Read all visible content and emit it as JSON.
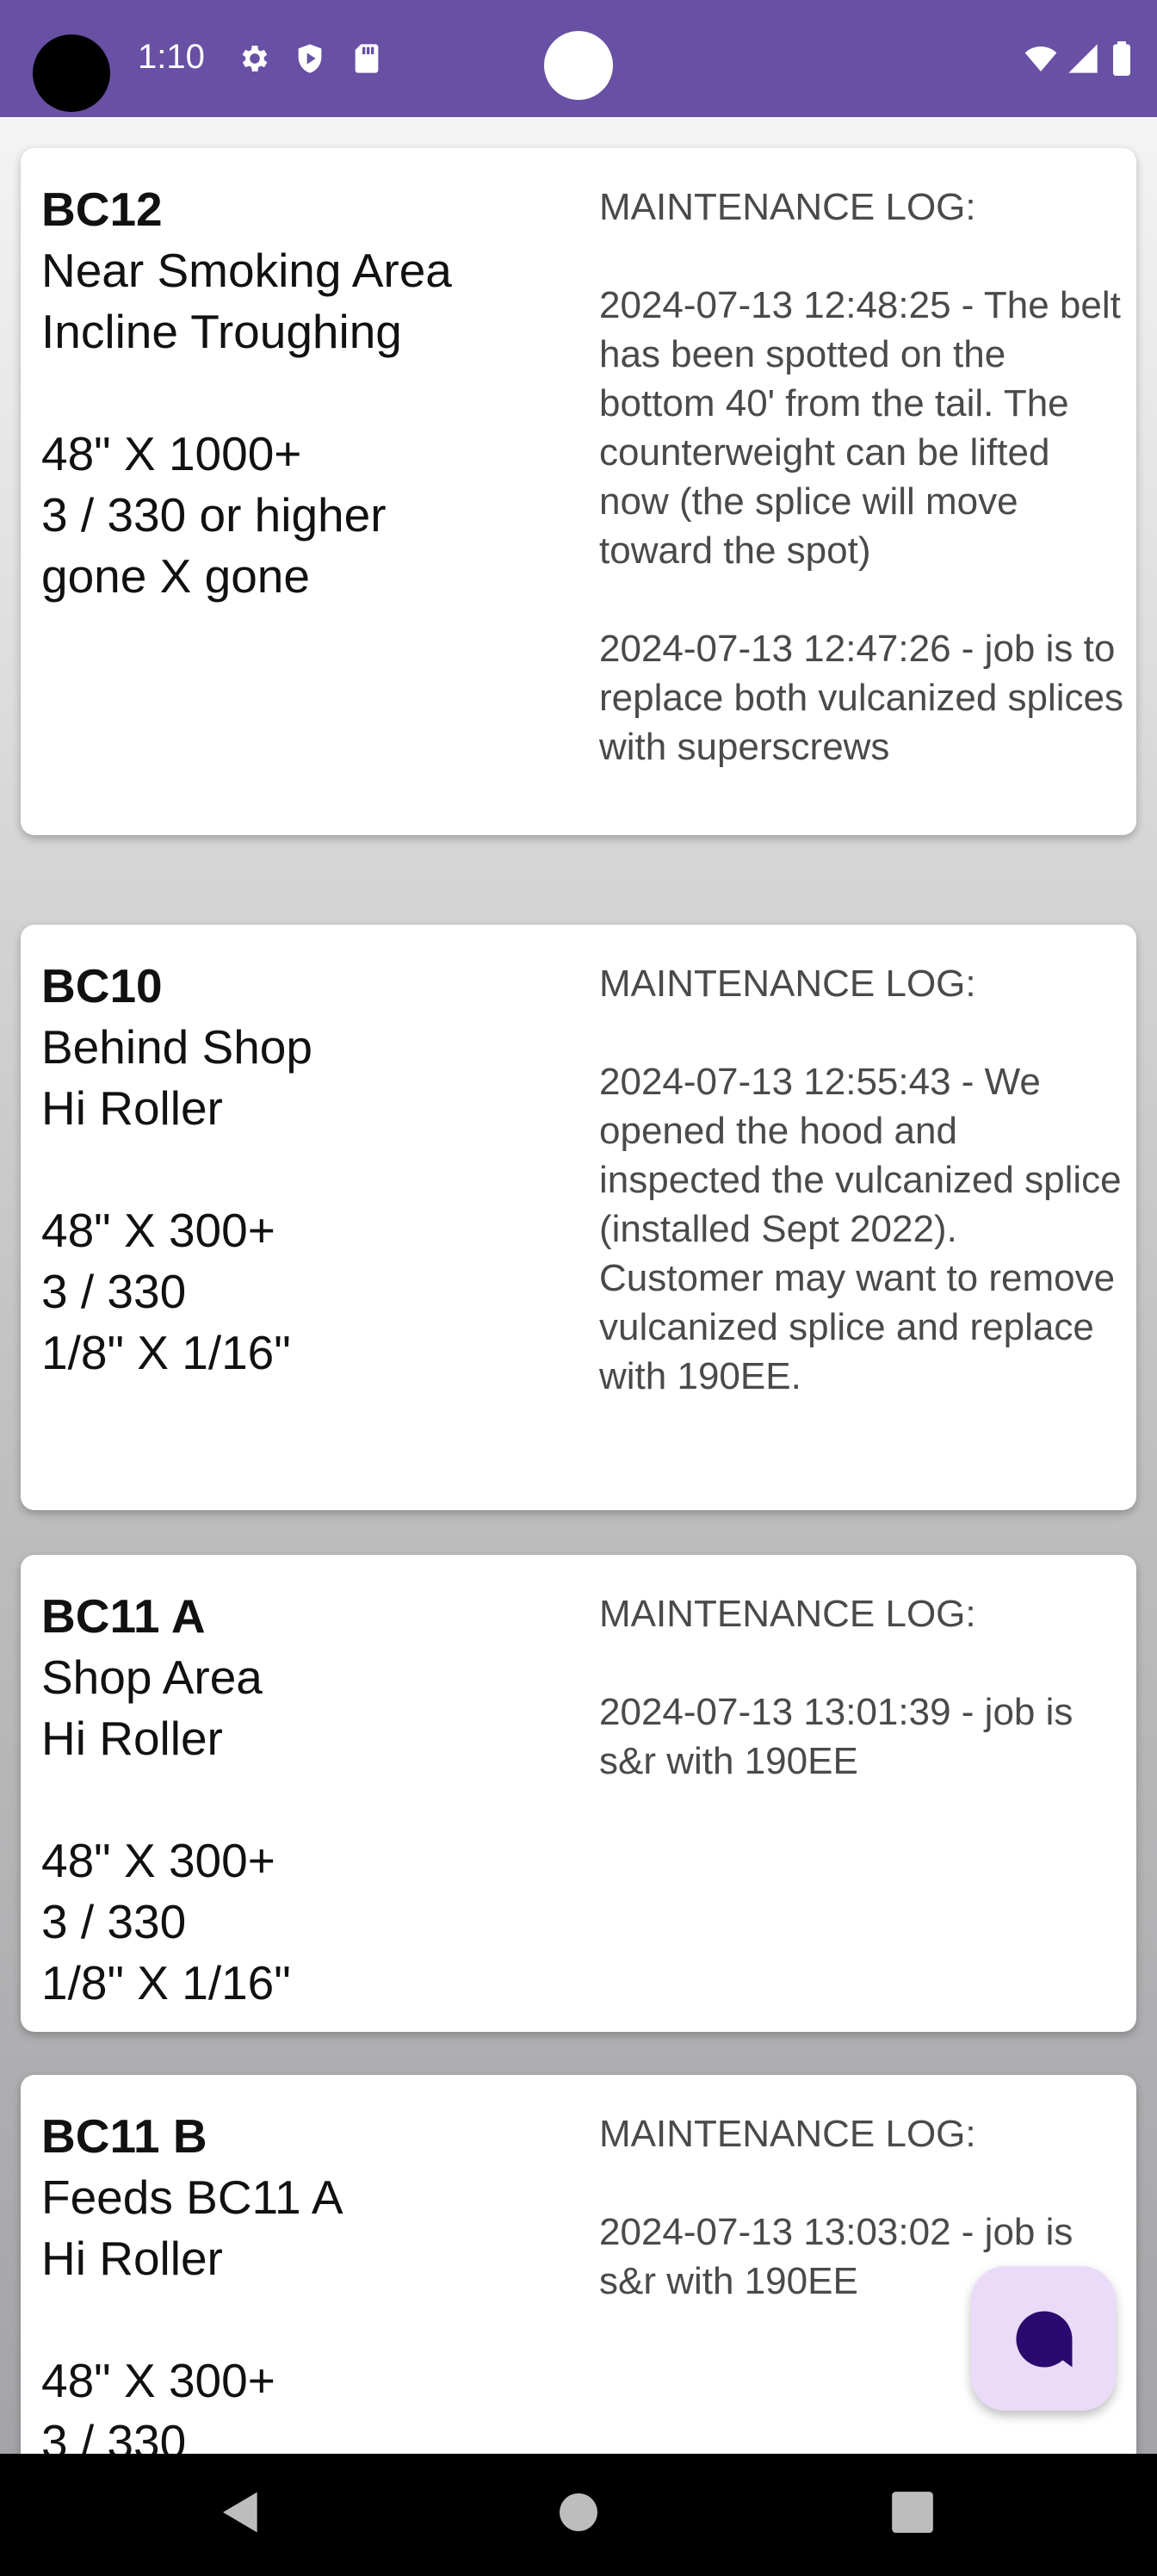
{
  "status_bar": {
    "time": "1:10",
    "icons": [
      "settings-gear-icon",
      "shield-icon",
      "sd-card-icon",
      "wifi-icon",
      "signal-icon",
      "battery-icon"
    ],
    "color": "#6850a4"
  },
  "cards": [
    {
      "code": "BC12",
      "location": "Near Smoking Area",
      "type": "Incline Troughing",
      "size": "48\" X 1000+",
      "ply": "3 / 330 or higher",
      "cover": "gone X gone",
      "log_header": "MAINTENANCE LOG:",
      "log_entries": [
        "2024-07-13 12:48:25 - The belt has been spotted on the bottom 40' from the tail. The counterweight can be lifted now (the splice will move toward the spot)",
        "2024-07-13 12:47:26 - job is to replace both vulcanized splices with superscrews"
      ]
    },
    {
      "code": "BC10",
      "location": "Behind Shop",
      "type": "Hi Roller",
      "size": "48\" X 300+",
      "ply": "3 / 330",
      "cover": "1/8\" X 1/16\"",
      "log_header": "MAINTENANCE LOG:",
      "log_entries": [
        "2024-07-13 12:55:43 - We opened the hood and inspected the vulcanized splice (installed Sept 2022). Customer may want to remove vulcanized splice and replace with 190EE."
      ]
    },
    {
      "code": "BC11 A",
      "location": "Shop Area",
      "type": "Hi Roller",
      "size": "48\" X 300+",
      "ply": "3 / 330",
      "cover": "1/8\" X 1/16\"",
      "log_header": "MAINTENANCE LOG:",
      "log_entries": [
        "2024-07-13 13:01:39 - job is s&r with 190EE"
      ]
    },
    {
      "code": "BC11 B",
      "location": "Feeds BC11 A",
      "type": "Hi Roller",
      "size": "48\" X 300+",
      "ply": "3 / 330",
      "cover": "",
      "log_header": "MAINTENANCE LOG:",
      "log_entries": [
        "2024-07-13 13:03:02 - job is s&r with 190EE"
      ]
    }
  ],
  "fab": {
    "icon": "chat-icon",
    "color": "#eadcf8"
  },
  "nav_bar": {
    "icons": [
      "back-icon",
      "home-icon",
      "recents-icon"
    ]
  }
}
